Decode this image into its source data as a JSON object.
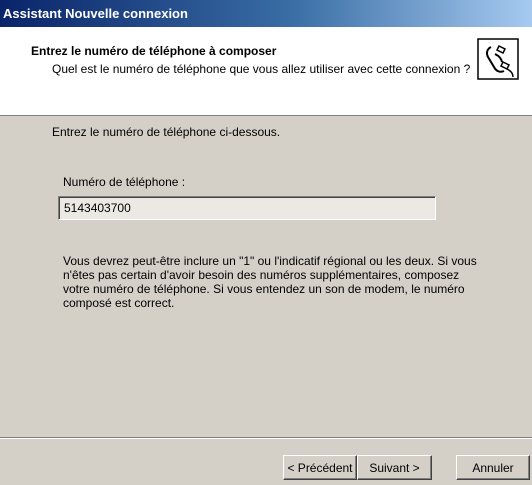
{
  "window": {
    "title": "Assistant Nouvelle connexion"
  },
  "header": {
    "title": "Entrez le numéro de téléphone à composer",
    "subtitle": "Quel est le numéro de téléphone que vous allez utiliser avec cette connexion ?",
    "icon": "phone-icon"
  },
  "main": {
    "intro": "Entrez le numéro de téléphone ci-dessous.",
    "phone_label": "Numéro de téléphone :",
    "phone_value": "5143403700",
    "note": "Vous devrez peut-être inclure un \"1\" ou l'indicatif régional ou les deux. Si vous n'êtes pas certain d'avoir besoin des numéros supplémentaires, composez votre numéro de téléphone. Si vous entendez un son de modem, le numéro composé est correct."
  },
  "buttons": {
    "back": "< Précédent",
    "next": "Suivant >",
    "cancel": "Annuler"
  }
}
